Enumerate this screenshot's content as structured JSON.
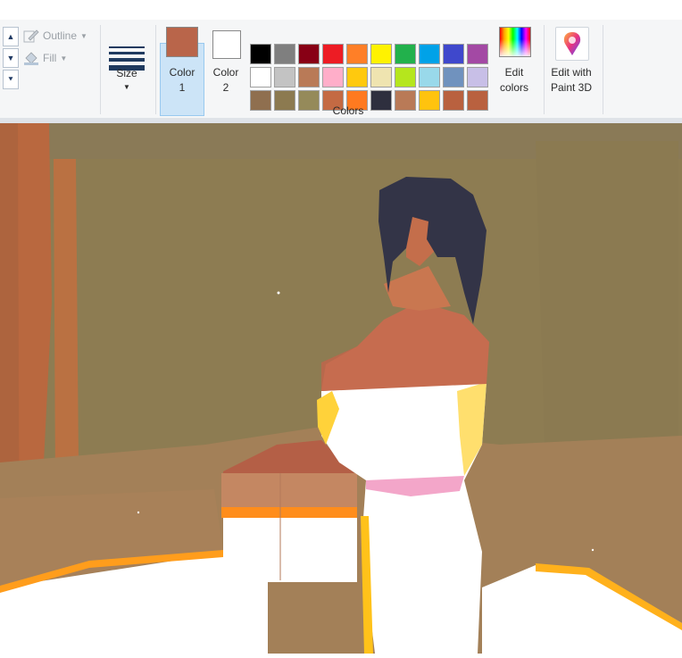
{
  "ribbon": {
    "shapes_group": {
      "outline_label": "Outline",
      "fill_label": "Fill"
    },
    "size_label": "Size",
    "color1_label": "Color\n1",
    "color1_line1": "Color",
    "color1_line2": "1",
    "color2_line1": "Color",
    "color2_line2": "2",
    "colors_group_label": "Colors",
    "edit_colors_line1": "Edit",
    "edit_colors_line2": "colors",
    "edit_p3d_line1": "Edit with",
    "edit_p3d_line2": "Paint 3D",
    "color1_value": "#b9654a",
    "color2_value": "#ffffff",
    "palette": [
      "#000000",
      "#7f7f7f",
      "#880015",
      "#ed1c24",
      "#ff7f27",
      "#fff200",
      "#22b14c",
      "#00a2e8",
      "#3f48cc",
      "#a349a4",
      "#ffffff",
      "#c3c3c3",
      "#b97a57",
      "#ffaec9",
      "#ffc90e",
      "#efe4b0",
      "#b5e61d",
      "#99d9ea",
      "#7092be",
      "#c8bfe7",
      "#8f6f4f",
      "#8c7a50",
      "#958a5a",
      "#c46a43",
      "#ff7a20",
      "#2e2f3e",
      "#b97a57",
      "#ffc30e",
      "#b9613f",
      "#b9613f"
    ]
  },
  "canvas": {
    "description_colors": {
      "wall": "#8d7c52",
      "floor": "#a57f58",
      "skin": "#c76f4f",
      "hair": "#34344a",
      "dress": "#ffffff",
      "glow": "#ff9a1f"
    }
  }
}
